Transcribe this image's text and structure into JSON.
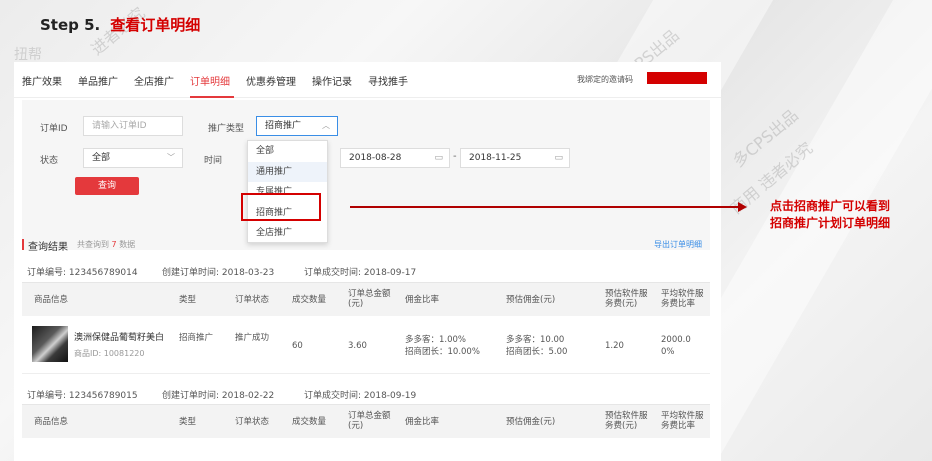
{
  "heading": {
    "step": "Step 5.",
    "title": "查看订单明细"
  },
  "watermarks": [
    "扭帮",
    "进者必究",
    "CPS出品",
    "多CPS出品",
    "商用 违者必究",
    "违者必究"
  ],
  "nav": {
    "items": [
      "推广效果",
      "单品推广",
      "全店推广",
      "订单明细",
      "优惠券管理",
      "操作记录",
      "寻找推手"
    ],
    "active_index": 3,
    "invite_label": "我绑定的邀请码"
  },
  "filters": {
    "order_id_label": "订单ID",
    "order_id_placeholder": "请输入订单ID",
    "promo_type_label": "推广类型",
    "promo_type_value": "招商推广",
    "status_label": "状态",
    "status_value": "全部",
    "time_label": "时间",
    "date_start": "2018-08-28",
    "date_sep": "-",
    "date_end": "2018-11-25",
    "query_button": "查询"
  },
  "dropdown": {
    "options": [
      "全部",
      "通用推广",
      "专属推广",
      "招商推广",
      "全店推广"
    ],
    "hover_index": 1,
    "highlight_index": 3
  },
  "results": {
    "title": "查询结果",
    "count_prefix": "共查询到",
    "count": "7",
    "count_suffix": "数据",
    "export": "导出订单明细"
  },
  "table_headers": [
    "商品信息",
    "类型",
    "订单状态",
    "成交数量",
    "订单总金额(元)",
    "佣金比率",
    "预估佣金(元)",
    "预估软件服务费(元)",
    "平均软件服务费比率"
  ],
  "orders": [
    {
      "order_no": "订单编号: 123456789014",
      "created": "创建订单时间: 2018-03-23",
      "completed": "订单成交时间: 2018-09-17",
      "row": {
        "product_name": "澳洲保健品葡萄籽美白",
        "product_id": "商品ID: 10081220",
        "type": "招商推广",
        "status": "推广成功",
        "qty": "60",
        "amount": "3.60",
        "rate_1": "多多客：1.00%",
        "rate_2": "招商团长：10.00%",
        "comm_1": "多多客：10.00",
        "comm_2": "招商团长：5.00",
        "service_fee": "1.20",
        "avg_rate": "2000.00%"
      }
    },
    {
      "order_no": "订单编号: 123456789015",
      "created": "创建订单时间: 2018-02-22",
      "completed": "订单成交时间: 2018-09-19"
    }
  ],
  "callout": {
    "line1": "点击招商推广可以看到",
    "line2": "招商推广计划订单明细"
  },
  "colors": {
    "accent": "#e4393c",
    "callout": "#d40000",
    "link": "#3a8ee6"
  }
}
